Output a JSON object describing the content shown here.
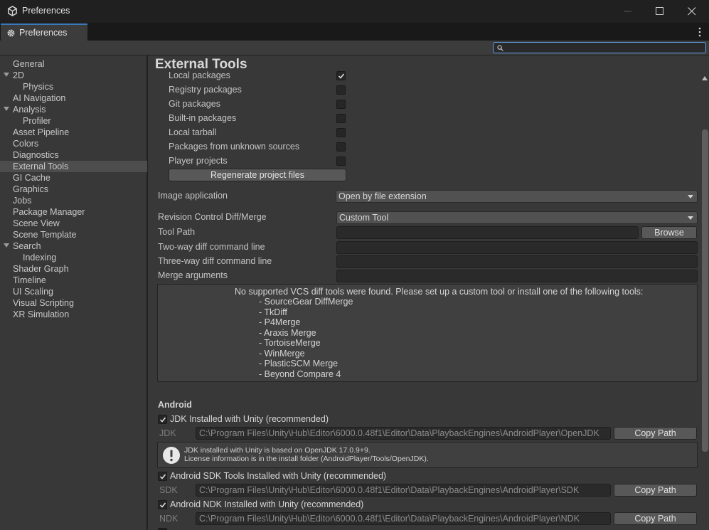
{
  "window": {
    "title": "Preferences"
  },
  "tab": {
    "label": "Preferences"
  },
  "search": {
    "placeholder": "",
    "value": ""
  },
  "sidebar": {
    "items": [
      {
        "label": "General",
        "indent": 0
      },
      {
        "label": "2D",
        "indent": 0,
        "expandable": true
      },
      {
        "label": "Physics",
        "indent": 1
      },
      {
        "label": "AI Navigation",
        "indent": 0
      },
      {
        "label": "Analysis",
        "indent": 0,
        "expandable": true
      },
      {
        "label": "Profiler",
        "indent": 1
      },
      {
        "label": "Asset Pipeline",
        "indent": 0
      },
      {
        "label": "Colors",
        "indent": 0
      },
      {
        "label": "Diagnostics",
        "indent": 0
      },
      {
        "label": "External Tools",
        "indent": 0,
        "selected": true
      },
      {
        "label": "GI Cache",
        "indent": 0
      },
      {
        "label": "Graphics",
        "indent": 0
      },
      {
        "label": "Jobs",
        "indent": 0
      },
      {
        "label": "Package Manager",
        "indent": 0
      },
      {
        "label": "Scene View",
        "indent": 0
      },
      {
        "label": "Scene Template",
        "indent": 0
      },
      {
        "label": "Search",
        "indent": 0,
        "expandable": true
      },
      {
        "label": "Indexing",
        "indent": 1
      },
      {
        "label": "Shader Graph",
        "indent": 0
      },
      {
        "label": "Timeline",
        "indent": 0
      },
      {
        "label": "UI Scaling",
        "indent": 0
      },
      {
        "label": "Visual Scripting",
        "indent": 0
      },
      {
        "label": "XR Simulation",
        "indent": 0
      }
    ]
  },
  "content": {
    "title": "External Tools",
    "packages": [
      {
        "label": "Local packages",
        "checked": true
      },
      {
        "label": "Registry packages",
        "checked": false
      },
      {
        "label": "Git packages",
        "checked": false
      },
      {
        "label": "Built-in packages",
        "checked": false
      },
      {
        "label": "Local tarball",
        "checked": false
      },
      {
        "label": "Packages from unknown sources",
        "checked": false
      },
      {
        "label": "Player projects",
        "checked": false
      }
    ],
    "regenerate_label": "Regenerate project files",
    "image_app": {
      "label": "Image application",
      "value": "Open by file extension"
    },
    "diff_merge": {
      "label": "Revision Control Diff/Merge",
      "value": "Custom Tool"
    },
    "tool_path": {
      "label": "Tool Path",
      "value": "",
      "browse_label": "Browse"
    },
    "two_way": {
      "label": "Two-way diff command line",
      "value": ""
    },
    "three_way": {
      "label": "Three-way diff command line",
      "value": ""
    },
    "merge_args": {
      "label": "Merge arguments",
      "value": ""
    },
    "vcs_help": {
      "message": "No supported VCS diff tools were found. Please set up a custom tool or install one of the following tools:",
      "tools": [
        "- SourceGear DiffMerge",
        "- TkDiff",
        "- P4Merge",
        "- Araxis Merge",
        "- TortoiseMerge",
        "- WinMerge",
        "- PlasticSCM Merge",
        "- Beyond Compare 4"
      ]
    },
    "android": {
      "section_label": "Android",
      "jdk": {
        "checkbox_label": "JDK Installed with Unity (recommended)",
        "checked": true,
        "field_label": "JDK",
        "path": "C:\\Program Files\\Unity\\Hub\\Editor\\6000.0.48f1\\Editor\\Data\\PlaybackEngines\\AndroidPlayer\\OpenJDK",
        "copy_label": "Copy Path",
        "info_line1": "JDK installed with Unity is based on OpenJDK 17.0.9+9.",
        "info_line2": "License information is in the install folder (AndroidPlayer/Tools/OpenJDK)."
      },
      "sdk": {
        "checkbox_label": "Android SDK Tools Installed with Unity (recommended)",
        "checked": true,
        "field_label": "SDK",
        "path": "C:\\Program Files\\Unity\\Hub\\Editor\\6000.0.48f1\\Editor\\Data\\PlaybackEngines\\AndroidPlayer\\SDK",
        "copy_label": "Copy Path"
      },
      "ndk": {
        "checkbox_label": "Android NDK Installed with Unity (recommended)",
        "checked": true,
        "field_label": "NDK",
        "path": "C:\\Program Files\\Unity\\Hub\\Editor\\6000.0.48f1\\Editor\\Data\\PlaybackEngines\\AndroidPlayer\\NDK",
        "copy_label": "Copy Path"
      }
    }
  },
  "colors": {
    "accent": "#3a79bb",
    "search_focus": "#5fa0e6",
    "selected": "#4d4d4d"
  }
}
